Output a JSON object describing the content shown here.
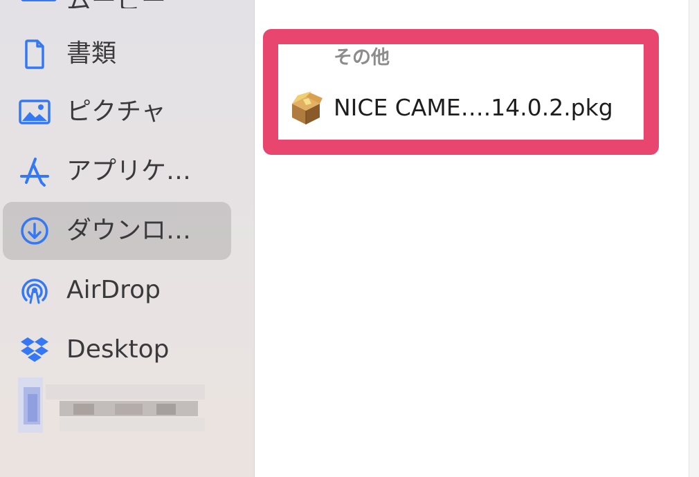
{
  "sidebar": {
    "cutoff_item": {
      "label": "ムービー",
      "icon": "film-icon"
    },
    "items": [
      {
        "label": "書類",
        "icon": "document-icon",
        "selected": false
      },
      {
        "label": "ピクチャ",
        "icon": "photo-icon",
        "selected": false
      },
      {
        "label": "アプリケ…",
        "icon": "app-store-icon",
        "selected": false
      },
      {
        "label": "ダウンロ…",
        "icon": "download-circle-icon",
        "selected": true
      },
      {
        "label": "AirDrop",
        "icon": "airdrop-icon",
        "selected": false
      },
      {
        "label": "Desktop",
        "icon": "dropbox-icon",
        "selected": false
      }
    ]
  },
  "main": {
    "section_header": "その他",
    "files": [
      {
        "name": "NICE CAME….14.0.2.pkg",
        "icon": "package-icon"
      }
    ]
  },
  "colors": {
    "accent": "#3478f6",
    "highlight_border": "#e8466f",
    "selected_bg": "#d3cfd0"
  }
}
